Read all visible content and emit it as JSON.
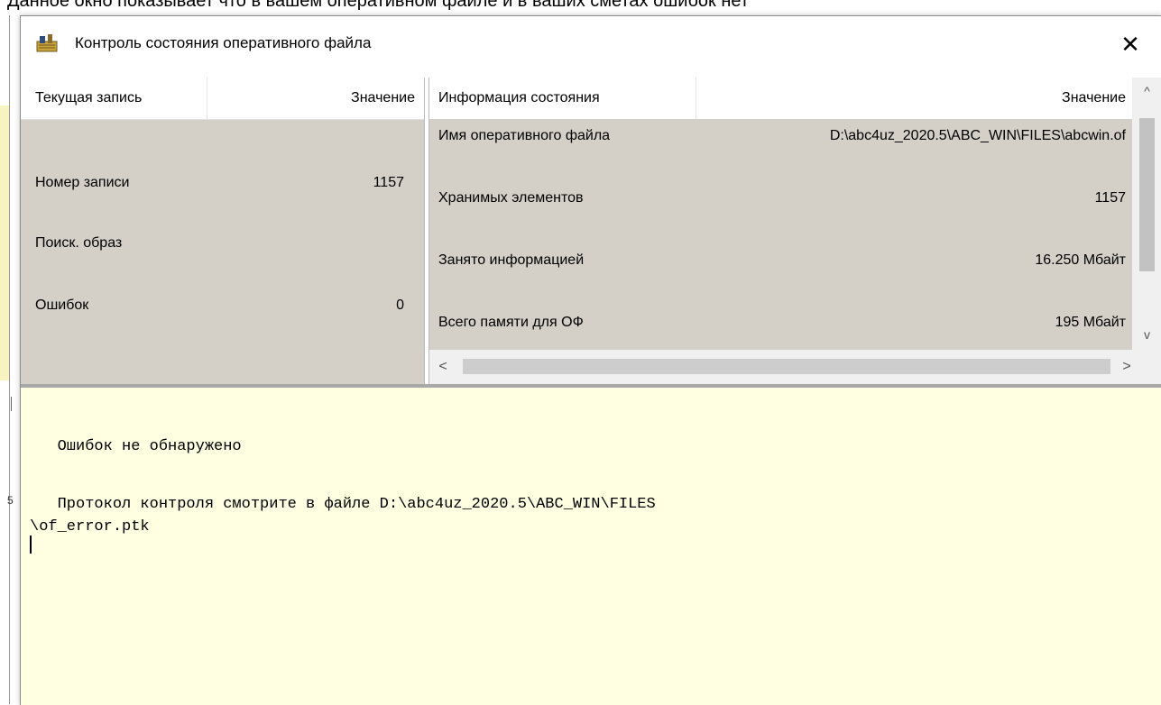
{
  "background": {
    "caption": "Данное окно показывает что в вашем оперативном файле и в ваших сметах ошибок нет",
    "side_letter": "5"
  },
  "window": {
    "title": "Контроль состояния оперативного файла",
    "close_glyph": "✕",
    "icon": "app-tool-icon"
  },
  "left_table": {
    "headers": [
      "Текущая запись",
      "Значение"
    ],
    "rows": [
      {
        "label": "Номер записи",
        "value": "1157"
      },
      {
        "label": "Поиск. образ",
        "value": ""
      },
      {
        "label": "Ошибок",
        "value": "0"
      }
    ]
  },
  "right_table": {
    "headers": [
      "Информация состояния",
      "Значение"
    ],
    "rows": [
      {
        "label": "Имя оперативного файла",
        "value": "D:\\abc4uz_2020.5\\ABC_WIN\\FILES\\abcwin.of"
      },
      {
        "label": "Хранимых элементов",
        "value": "1157"
      },
      {
        "label": "Занято информацией",
        "value": "16.250 Мбайт"
      },
      {
        "label": "Всего памяти для ОФ",
        "value": "195 Мбайт"
      }
    ]
  },
  "scrollbars": {
    "up": "^",
    "down": "v",
    "left": "<",
    "right": ">"
  },
  "log": {
    "lines": [
      "   Ошибок не обнаружено",
      "",
      "   Протокол контроля смотрите в файле D:\\abc4uz_2020.5\\ABC_WIN\\FILES",
      "\\of_error.ptk"
    ]
  },
  "colors": {
    "panel_bg": "#d4d0c8",
    "log_bg": "#ffffe1"
  }
}
